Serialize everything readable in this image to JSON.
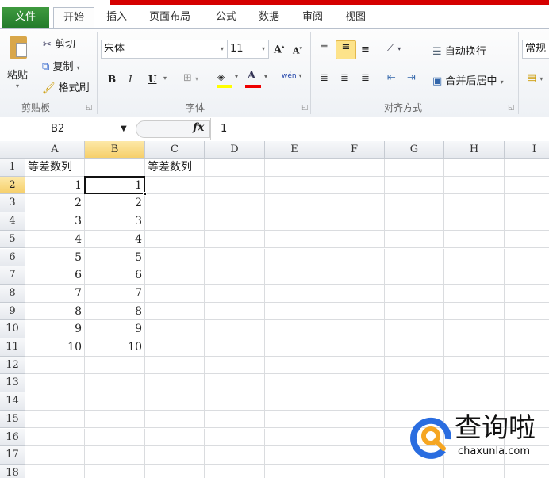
{
  "tabs": [
    "文件",
    "开始",
    "插入",
    "页面布局",
    "公式",
    "数据",
    "审阅",
    "视图"
  ],
  "clipboard": {
    "paste": "粘贴",
    "cut": "剪切",
    "copy": "复制",
    "format_painter": "格式刷",
    "label": "剪贴板"
  },
  "font": {
    "name": "宋体",
    "size": "11",
    "bold": "B",
    "italic": "I",
    "underline": "U",
    "grow": "A",
    "shrink": "A",
    "color_glyph": "A",
    "phonetic": "wén",
    "label": "字体",
    "fill_color": "#ffff00",
    "font_color": "#e00000"
  },
  "alignment": {
    "wrap": "自动换行",
    "merge": "合并后居中",
    "label": "对齐方式"
  },
  "number": {
    "format": "常规"
  },
  "formula_bar": {
    "name_box": "B2",
    "fx": "fx",
    "value": "1"
  },
  "columns": [
    "A",
    "B",
    "C",
    "D",
    "E",
    "F",
    "G",
    "H",
    "I"
  ],
  "rows": [
    "1",
    "2",
    "3",
    "4",
    "5",
    "6",
    "7",
    "8",
    "9",
    "10",
    "11",
    "12",
    "13",
    "14",
    "15",
    "16",
    "17",
    "18"
  ],
  "cells": {
    "A1": "等差数列",
    "C1": "等差数列",
    "A2": "1",
    "B2": "1",
    "A3": "2",
    "B3": "2",
    "A4": "3",
    "B4": "3",
    "A5": "4",
    "B5": "4",
    "A6": "5",
    "B6": "5",
    "A7": "6",
    "B7": "6",
    "A8": "7",
    "B8": "7",
    "A9": "8",
    "B9": "8",
    "A10": "9",
    "B10": "9",
    "A11": "10",
    "B11": "10"
  },
  "active_cell": "B2",
  "watermark": {
    "text": "查询啦",
    "url_text": "chaxunla.com"
  }
}
